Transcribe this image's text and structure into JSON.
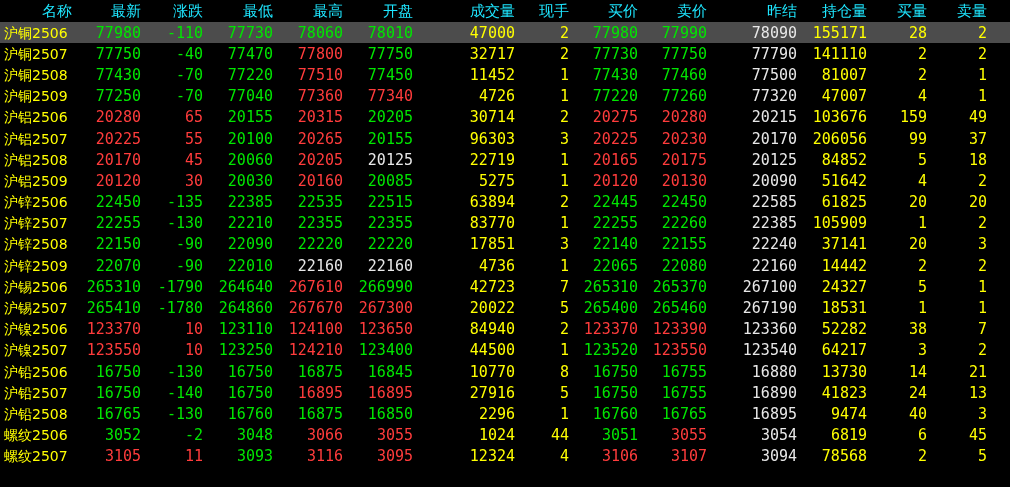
{
  "columns": [
    "名称",
    "最新",
    "涨跌",
    "最低",
    "最高",
    "开盘",
    "成交量",
    "现手",
    "买价",
    "卖价",
    "昨结",
    "持仓量",
    "买量",
    "卖量"
  ],
  "rows": [
    {
      "selected": true,
      "cells": [
        "沪铜2506",
        "77980",
        "-110",
        "77730",
        "78060",
        "78010",
        "47000",
        "2",
        "77980",
        "77990",
        "78090",
        "155171",
        "28",
        "2"
      ]
    },
    {
      "selected": false,
      "cells": [
        "沪铜2507",
        "77750",
        "-40",
        "77470",
        "77800",
        "77750",
        "32717",
        "2",
        "77730",
        "77750",
        "77790",
        "141110",
        "2",
        "2"
      ]
    },
    {
      "selected": false,
      "cells": [
        "沪铜2508",
        "77430",
        "-70",
        "77220",
        "77510",
        "77450",
        "11452",
        "1",
        "77430",
        "77460",
        "77500",
        "81007",
        "2",
        "1"
      ]
    },
    {
      "selected": false,
      "cells": [
        "沪铜2509",
        "77250",
        "-70",
        "77040",
        "77360",
        "77340",
        "4726",
        "1",
        "77220",
        "77260",
        "77320",
        "47007",
        "4",
        "1"
      ]
    },
    {
      "selected": false,
      "cells": [
        "沪铝2506",
        "20280",
        "65",
        "20155",
        "20315",
        "20205",
        "30714",
        "2",
        "20275",
        "20280",
        "20215",
        "103676",
        "159",
        "49"
      ]
    },
    {
      "selected": false,
      "cells": [
        "沪铝2507",
        "20225",
        "55",
        "20100",
        "20265",
        "20155",
        "96303",
        "3",
        "20225",
        "20230",
        "20170",
        "206056",
        "99",
        "37"
      ]
    },
    {
      "selected": false,
      "cells": [
        "沪铝2508",
        "20170",
        "45",
        "20060",
        "20205",
        "20125",
        "22719",
        "1",
        "20165",
        "20175",
        "20125",
        "84852",
        "5",
        "18"
      ]
    },
    {
      "selected": false,
      "cells": [
        "沪铝2509",
        "20120",
        "30",
        "20030",
        "20160",
        "20085",
        "5275",
        "1",
        "20120",
        "20130",
        "20090",
        "51642",
        "4",
        "2"
      ]
    },
    {
      "selected": false,
      "cells": [
        "沪锌2506",
        "22450",
        "-135",
        "22385",
        "22535",
        "22515",
        "63894",
        "2",
        "22445",
        "22450",
        "22585",
        "61825",
        "20",
        "20"
      ]
    },
    {
      "selected": false,
      "cells": [
        "沪锌2507",
        "22255",
        "-130",
        "22210",
        "22355",
        "22355",
        "83770",
        "1",
        "22255",
        "22260",
        "22385",
        "105909",
        "1",
        "2"
      ]
    },
    {
      "selected": false,
      "cells": [
        "沪锌2508",
        "22150",
        "-90",
        "22090",
        "22220",
        "22220",
        "17851",
        "3",
        "22140",
        "22155",
        "22240",
        "37141",
        "20",
        "3"
      ]
    },
    {
      "selected": false,
      "cells": [
        "沪锌2509",
        "22070",
        "-90",
        "22010",
        "22160",
        "22160",
        "4736",
        "1",
        "22065",
        "22080",
        "22160",
        "14442",
        "2",
        "2"
      ]
    },
    {
      "selected": false,
      "cells": [
        "沪锡2506",
        "265310",
        "-1790",
        "264640",
        "267610",
        "266990",
        "42723",
        "7",
        "265310",
        "265370",
        "267100",
        "24327",
        "5",
        "1"
      ]
    },
    {
      "selected": false,
      "cells": [
        "沪锡2507",
        "265410",
        "-1780",
        "264860",
        "267670",
        "267300",
        "20022",
        "5",
        "265400",
        "265460",
        "267190",
        "18531",
        "1",
        "1"
      ]
    },
    {
      "selected": false,
      "cells": [
        "沪镍2506",
        "123370",
        "10",
        "123110",
        "124100",
        "123650",
        "84940",
        "2",
        "123370",
        "123390",
        "123360",
        "52282",
        "38",
        "7"
      ]
    },
    {
      "selected": false,
      "cells": [
        "沪镍2507",
        "123550",
        "10",
        "123250",
        "124210",
        "123400",
        "44500",
        "1",
        "123520",
        "123550",
        "123540",
        "64217",
        "3",
        "2"
      ]
    },
    {
      "selected": false,
      "cells": [
        "沪铅2506",
        "16750",
        "-130",
        "16750",
        "16875",
        "16845",
        "10770",
        "8",
        "16750",
        "16755",
        "16880",
        "13730",
        "14",
        "21"
      ]
    },
    {
      "selected": false,
      "cells": [
        "沪铅2507",
        "16750",
        "-140",
        "16750",
        "16895",
        "16895",
        "27916",
        "5",
        "16750",
        "16755",
        "16890",
        "41823",
        "24",
        "13"
      ]
    },
    {
      "selected": false,
      "cells": [
        "沪铅2508",
        "16765",
        "-130",
        "16760",
        "16875",
        "16850",
        "2296",
        "1",
        "16760",
        "16765",
        "16895",
        "9474",
        "40",
        "3"
      ]
    },
    {
      "selected": false,
      "cells": [
        "螺纹2506",
        "3052",
        "-2",
        "3048",
        "3066",
        "3055",
        "1024",
        "44",
        "3051",
        "3055",
        "3054",
        "6819",
        "6",
        "45"
      ]
    },
    {
      "selected": false,
      "cells": [
        "螺纹2507",
        "3105",
        "11",
        "3093",
        "3116",
        "3095",
        "12324",
        "4",
        "3106",
        "3107",
        "3094",
        "78568",
        "2",
        "5"
      ]
    }
  ]
}
